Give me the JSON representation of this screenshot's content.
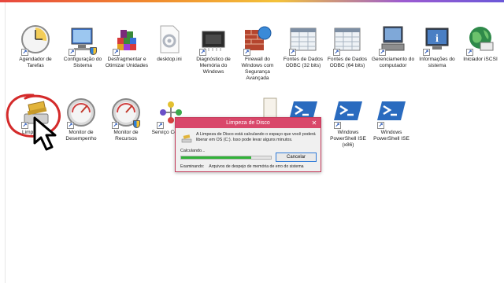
{
  "desktop": {
    "icons": [
      {
        "label": "Agendador de Tarefas",
        "icon": "clock-icon"
      },
      {
        "label": "Configuração do Sistema",
        "icon": "system-config-icon"
      },
      {
        "label": "Desfragmentar e Otimizar Unidades",
        "icon": "defrag-icon"
      },
      {
        "label": "desktop.ini",
        "icon": "settings-file-icon"
      },
      {
        "label": "Diagnóstico de Memória do Windows",
        "icon": "memory-chip-icon"
      },
      {
        "label": "Firewall do Windows com Segurança Avançada",
        "icon": "firewall-icon"
      },
      {
        "label": "Fontes de Dados ODBC (32 bits)",
        "icon": "odbc-icon"
      },
      {
        "label": "Fontes de Dados ODBC (64 bits)",
        "icon": "odbc-icon"
      },
      {
        "label": "Gerenciamento do computador",
        "icon": "computer-management-icon"
      },
      {
        "label": "Informações do sistema",
        "icon": "system-info-icon"
      },
      {
        "label": "Iniciador iSCSI",
        "icon": "globe-icon"
      },
      {
        "label": "Limpeza de",
        "icon": "disk-cleanup-icon"
      },
      {
        "label": "Monitor de Desempenho",
        "icon": "gauge-icon"
      },
      {
        "label": "Monitor de Recursos",
        "icon": "gauge-icon"
      },
      {
        "label": "Serviço Compon",
        "icon": "component-services-icon"
      },
      {
        "label": "",
        "icon": "document-icon"
      },
      {
        "label": "",
        "icon": "powershell-icon"
      },
      {
        "label": "Windows PowerShell ISE (x86)",
        "icon": "powershell-icon"
      },
      {
        "label": "Windows PowerShell ISE",
        "icon": "powershell-icon"
      }
    ]
  },
  "dialog": {
    "title": "Limpeza de Disco",
    "close": "✕",
    "message": "A Limpeza de Disco está calculando o espaço que você poderá liberar em OS (C:). Isso pode levar alguns minutos.",
    "calculating": "Calculando...",
    "progress_fraction": 0.78,
    "cancel": "Cancelar",
    "examining_label": "Examinando:",
    "examining_value": "Arquivos de despejo de memória de erro do sistema"
  },
  "colors": {
    "title_bar": "#d9476a",
    "progress": "#31b339",
    "annotation": "#d42a2a"
  }
}
